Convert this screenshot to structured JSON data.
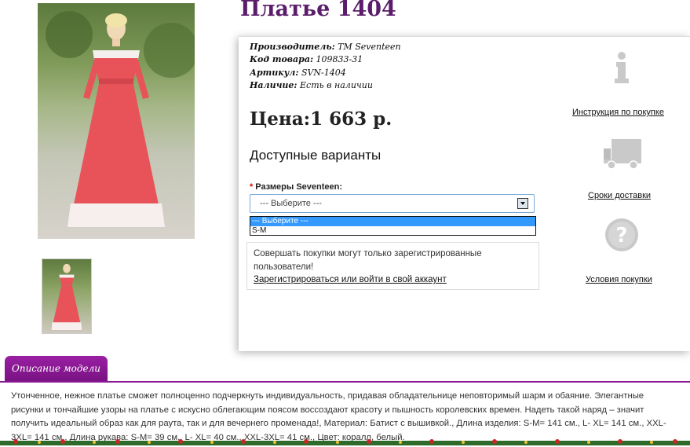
{
  "product": {
    "title": "Платье 1404",
    "manufacturer_label": "Производитель:",
    "manufacturer_value": "ТМ Seventeen",
    "code_label": "Код товара:",
    "code_value": "109833-31",
    "article_label": "Артикул:",
    "article_value": "SVN-1404",
    "availability_label": "Наличие:",
    "availability_value": "Есть в наличии",
    "price": "Цена:1 663 р."
  },
  "variants": {
    "title": "Доступные варианты",
    "required_mark": "*",
    "sizes_label": "Размеры Seventeen:",
    "selected_value": "--- Выберите ---",
    "options": [
      "--- Выберите ---",
      "S-M"
    ]
  },
  "notice": {
    "text": "Совершать покупки могут только зарегистрированные пользователи!",
    "link": "Зарегистрироваться или войти в свой аккаунт"
  },
  "sidebar": {
    "instruction_link": "Инструкция по покупке",
    "delivery_link": "Сроки доставки",
    "conditions_link": "Условия покупки"
  },
  "description": {
    "tab_label": "Описание модели",
    "text": "Утонченное, нежное платье сможет полноценно подчеркнуть индивидуальность, придавая обладательнице неповторимый шарм и обаяние. Элегантные рисунки и тончайшие узоры на платье с искусно облегающим поясом воссоздают красоту и пышность королевских времен. Надеть такой наряд – значит получить идеальный образ как для раута, так и для вечернего променада!, Материал: Батист с вышивкой., Длина изделия: S-M= 141 см., L- XL= 141 см., XXL-3XL= 141 см., Длина рукава: S-M= 39 см., L- XL= 40 см., XXL-3XL= 41 см., Цвет: коралл, белый."
  },
  "colors": {
    "title": "#5b1d6b",
    "tab": "#8a1a94",
    "dress": "#e8535a",
    "option_selected": "#3399ff"
  },
  "icons": [
    "info-icon",
    "truck-icon",
    "question-icon"
  ]
}
